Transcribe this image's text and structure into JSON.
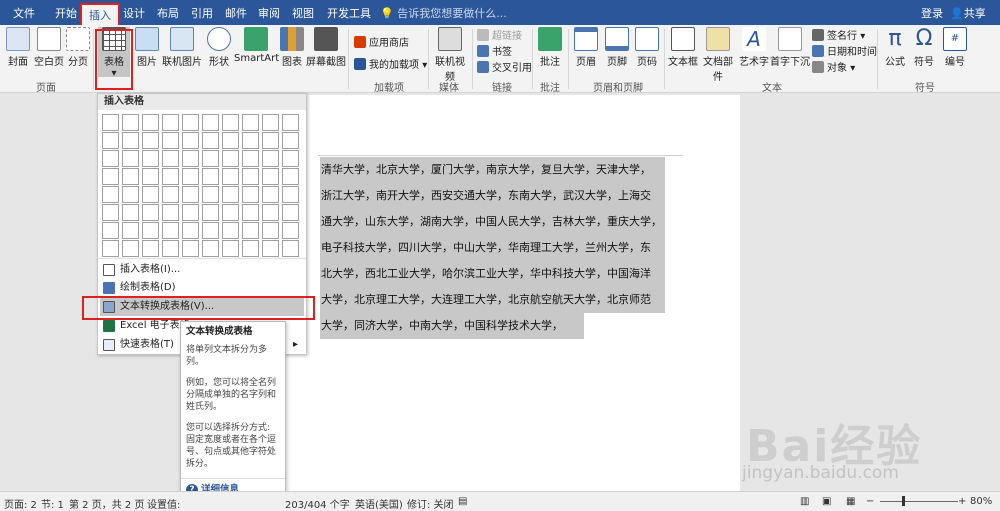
{
  "tabs": [
    "文件",
    "开始",
    "插入",
    "设计",
    "布局",
    "引用",
    "邮件",
    "审阅",
    "视图",
    "开发工具"
  ],
  "tell_me": "告诉我您想要做什么...",
  "login": "登录",
  "share": "共享",
  "ribbon": {
    "cover_page": "封面",
    "blank_page": "空白页",
    "page_break": "分页",
    "table": "表格",
    "picture": "图片",
    "online_picture": "联机图片",
    "shapes": "形状",
    "smartart": "SmartArt",
    "chart": "图表",
    "screenshot": "屏幕截图",
    "store": "应用商店",
    "my_addins": "我的加载项",
    "online_video": "联机视频",
    "hyperlink": "超链接",
    "bookmark": "书签",
    "cross_ref": "交叉引用",
    "comment": "批注",
    "header": "页眉",
    "footer": "页脚",
    "page_number": "页码",
    "textbox": "文本框",
    "quick_parts": "文档部件",
    "wordart": "艺术字",
    "dropcap": "首字下沉",
    "signature_line": "签名行",
    "date_time": "日期和时间",
    "object": "对象",
    "equation": "公式",
    "symbol": "符号",
    "number": "编号",
    "groups": {
      "pages": "页面",
      "addins": "加载项",
      "media": "媒体",
      "links": "链接",
      "comments": "批注",
      "header_footer": "页眉和页脚",
      "text": "文本",
      "symbols": "符号"
    }
  },
  "dropdown": {
    "title": "插入表格",
    "items": [
      "插入表格(I)...",
      "绘制表格(D)",
      "文本转换成表格(V)...",
      "Excel 电子表格",
      "快速表格(T)"
    ]
  },
  "tooltip": {
    "title": "文本转换成表格",
    "p1": "将单列文本拆分为多列。",
    "p2": "例如，您可以将全名列分隔成单独的名字列和姓氏列。",
    "p3": "您可以选择拆分方式: 固定宽度或者在各个逗号、句点或其他字符处拆分。",
    "more": "详细信息"
  },
  "document": {
    "lines": [
      "清华大学，北京大学，厦门大学，南京大学，复旦大学，天津大学，",
      "浙江大学，南开大学，西安交通大学，东南大学，武汉大学，上海交",
      "通大学，山东大学，湖南大学，中国人民大学，吉林大学，重庆大学，",
      "电子科技大学，四川大学，中山大学，华南理工大学，兰州大学，东",
      "北大学，西北工业大学，哈尔滨工业大学，华中科技大学，中国海洋",
      "大学，北京理工大学，大连理工大学，北京航空航天大学，北京师范",
      "大学，同济大学，中南大学，中国科学技术大学，"
    ]
  },
  "status": {
    "page": "页面: 2",
    "section": "节: 1",
    "pages": "第 2 页，共 2 页",
    "settings": "设置值:",
    "words": "203/404 个字",
    "language": "英语(美国)",
    "track": "修订: 关闭",
    "zoom": "80%"
  },
  "watermark": {
    "main": "Bai经验",
    "url": "jingyan.baidu.com"
  },
  "colors": {
    "brand": "#2b579a",
    "highlight_box": "#e02020",
    "selection": "#c8c8c8"
  }
}
